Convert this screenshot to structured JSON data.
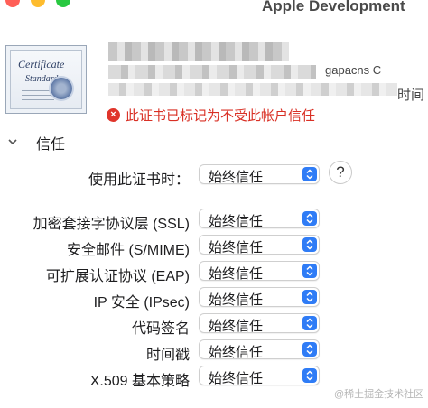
{
  "window": {
    "title": "Apple Development"
  },
  "certificate": {
    "icon_text_line1": "Certificate",
    "icon_text_line2": "Standard",
    "partial_text_1": "gapacns C",
    "partial_text_2": "时间",
    "warning": "此证书已标记为不受此帐户信任"
  },
  "trust": {
    "section_title": "信任",
    "when_using": {
      "label": "使用此证书时：",
      "value": "始终信任"
    },
    "help_label": "?",
    "rows": [
      {
        "label": "加密套接字协议层 (SSL)",
        "value": "始终信任"
      },
      {
        "label": "安全邮件 (S/MIME)",
        "value": "始终信任"
      },
      {
        "label": "可扩展认证协议 (EAP)",
        "value": "始终信任"
      },
      {
        "label": "IP 安全 (IPsec)",
        "value": "始终信任"
      },
      {
        "label": "代码签名",
        "value": "始终信任"
      },
      {
        "label": "时间戳",
        "value": "始终信任"
      },
      {
        "label": "X.509 基本策略",
        "value": "始终信任"
      }
    ]
  },
  "watermark": "@稀土掘金技术社区",
  "colors": {
    "accent": "#2f7cf6",
    "warning": "#d93025"
  }
}
